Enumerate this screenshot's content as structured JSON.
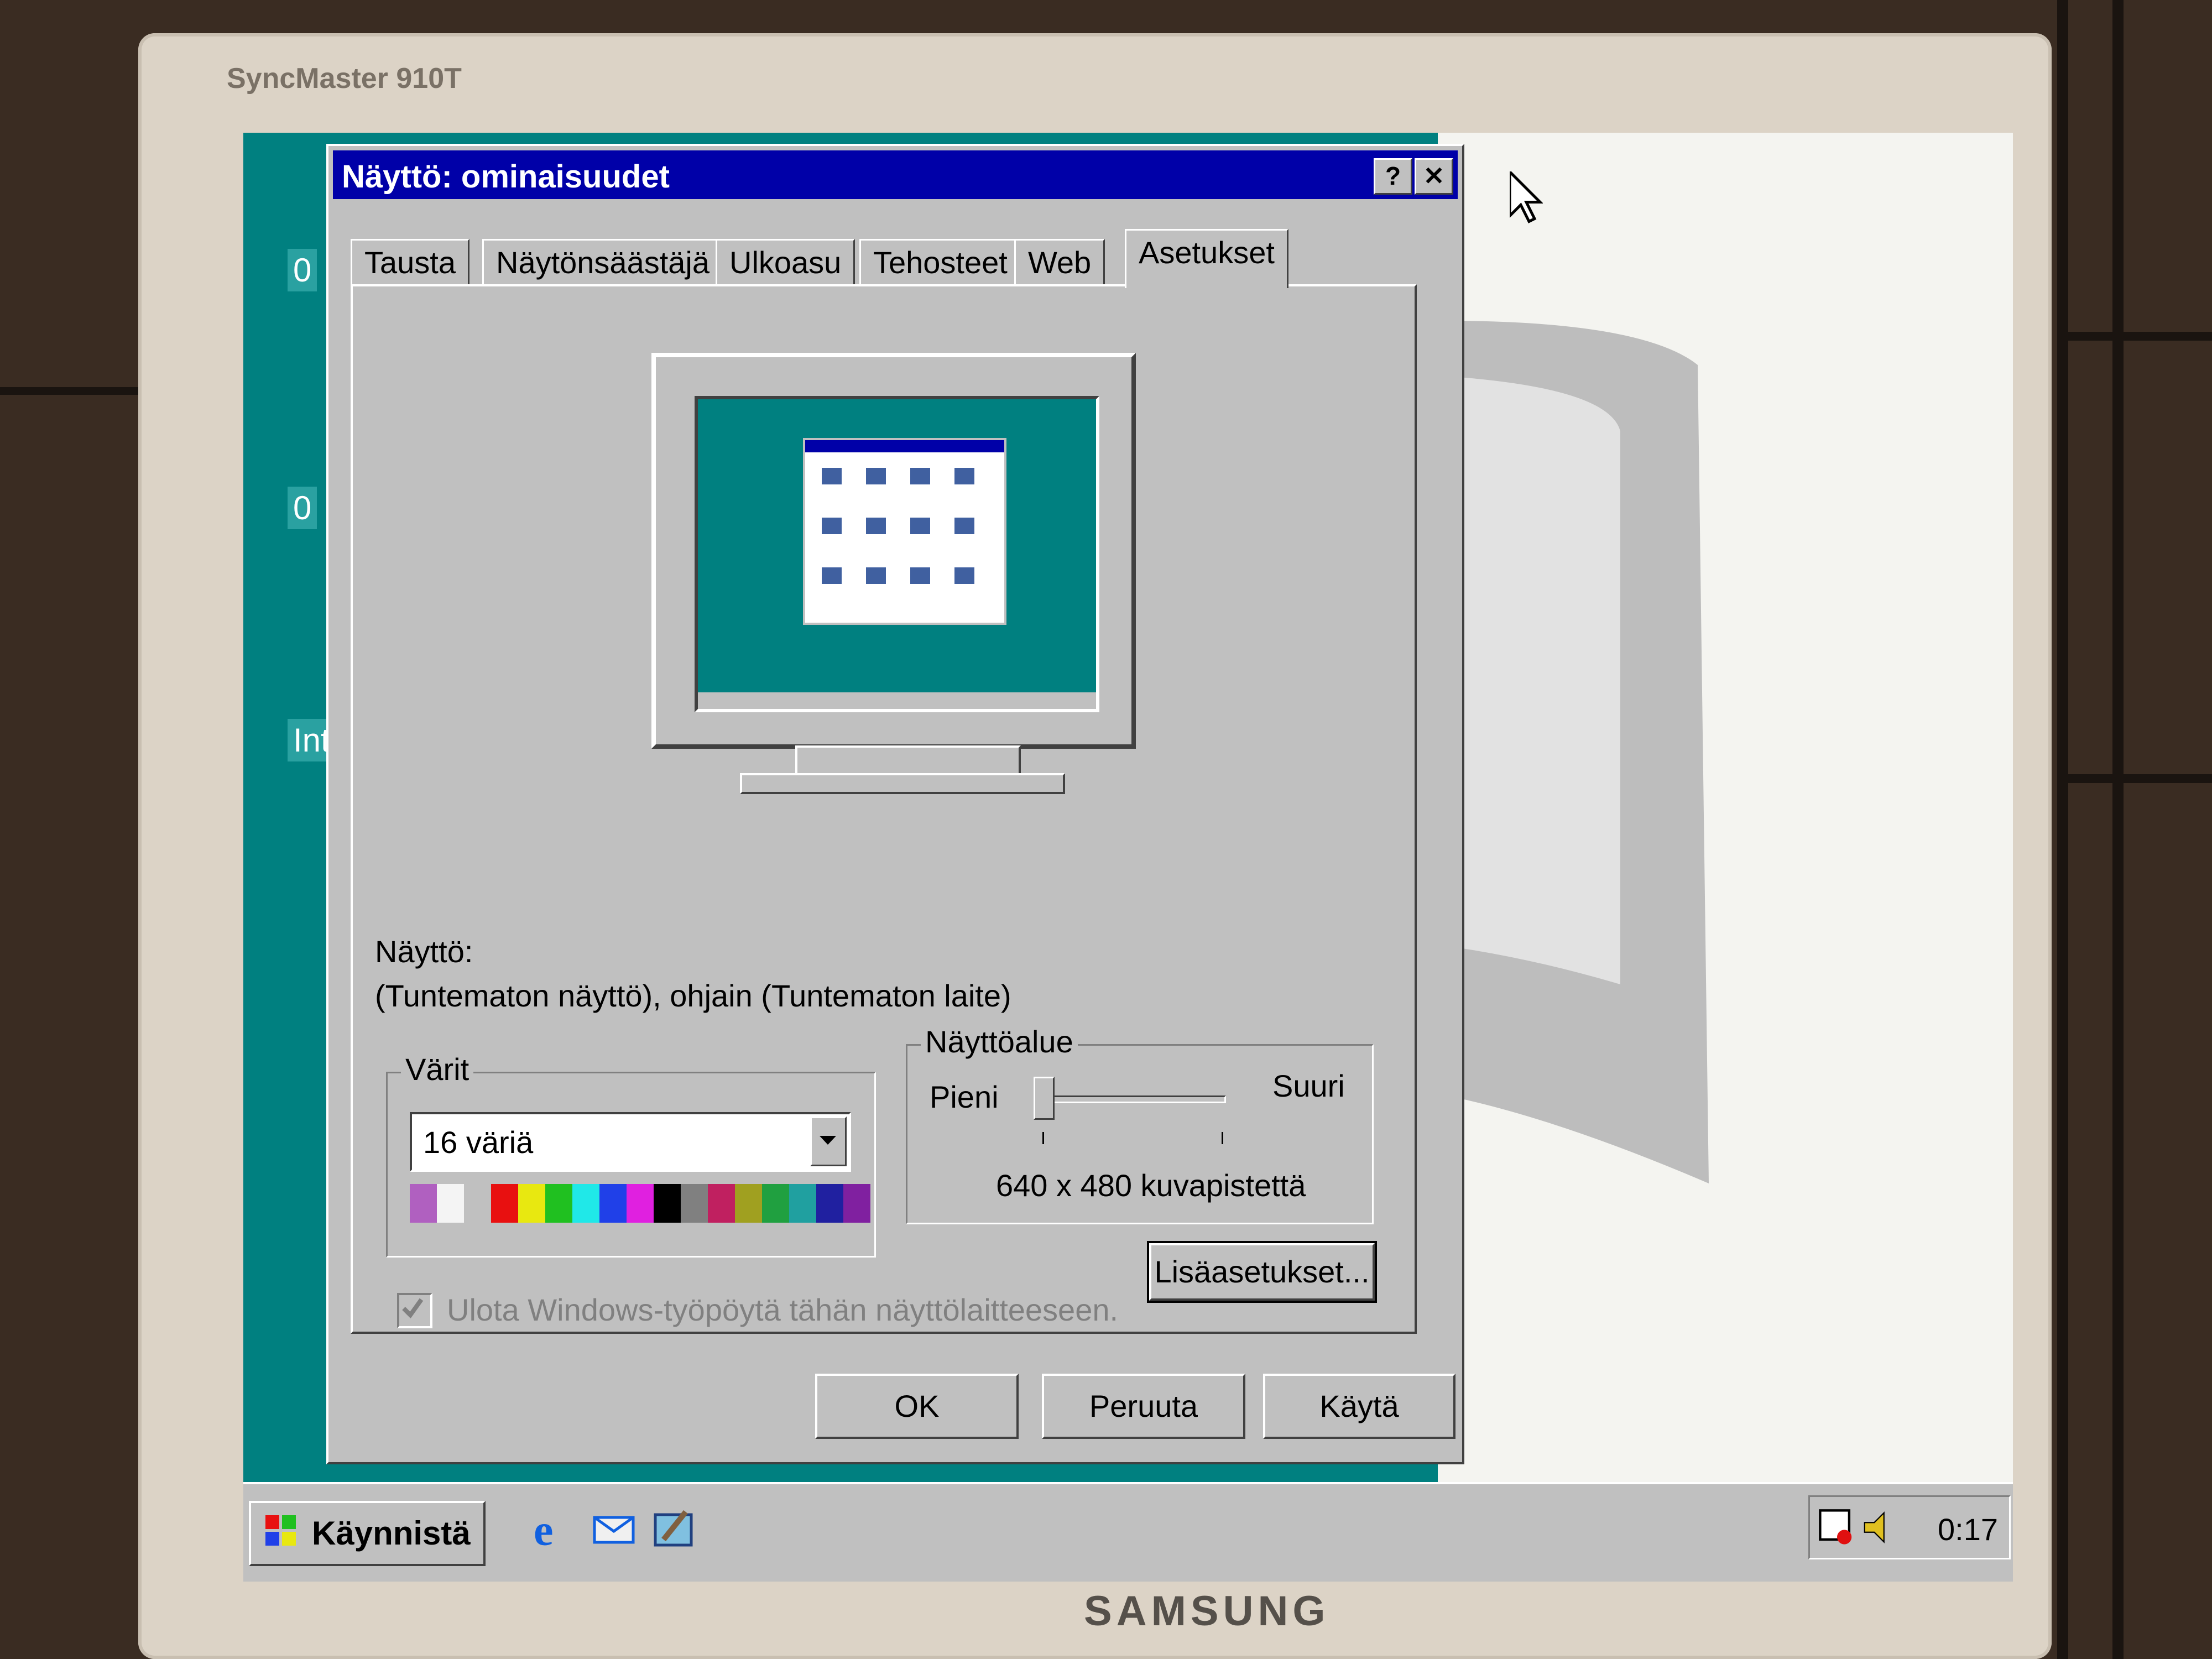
{
  "monitor": {
    "model": "SyncMaster 910T",
    "brand": "SAMSUNG"
  },
  "desktop": {
    "labels": [
      "0",
      "0",
      "Int"
    ]
  },
  "dialog": {
    "title": "Näyttö: ominaisuudet",
    "help_button": "?",
    "close_button": "✕",
    "tabs": [
      {
        "label": "Tausta",
        "active": false
      },
      {
        "label": "Näytönsäästäjä",
        "active": false
      },
      {
        "label": "Ulkoasu",
        "active": false
      },
      {
        "label": "Tehosteet",
        "active": false
      },
      {
        "label": "Web",
        "active": false
      },
      {
        "label": "Asetukset",
        "active": true
      }
    ],
    "display_heading": "Näyttö:",
    "display_device": "(Tuntematon näyttö), ohjain (Tuntematon laite)",
    "colors": {
      "label": "Värit",
      "selected": "16 väriä",
      "palette": [
        "#b060c0",
        "#f4f4f4",
        "#c0c0c0",
        "#e81010",
        "#e8e810",
        "#20c020",
        "#20e8e8",
        "#2040e8",
        "#e020e0",
        "#000000",
        "#808080",
        "#c02060",
        "#a0a020",
        "#20a040",
        "#20a0a0",
        "#2020a0",
        "#8020a0"
      ]
    },
    "screen_area": {
      "label": "Näyttöalue",
      "min_label": "Pieni",
      "max_label": "Suuri",
      "value_text": "640 x 480 kuvapistettä",
      "slider_position": 0
    },
    "extend_checkbox": {
      "label": "Ulota Windows-työpöytä tähän näyttölaitteeseen.",
      "checked": true,
      "disabled": true
    },
    "advanced_button": "Lisäasetukset...",
    "ok_button": "OK",
    "cancel_button": "Peruuta",
    "apply_button": "Käytä"
  },
  "taskbar": {
    "start_label": "Käynnistä",
    "quick_launch": [
      "internet-explorer-icon",
      "outlook-express-icon",
      "show-desktop-icon"
    ],
    "clock": "0:17"
  },
  "colors": {
    "title_bar": "#0000a8",
    "dialog_face": "#c0c0c0",
    "desktop_teal": "#008080"
  }
}
